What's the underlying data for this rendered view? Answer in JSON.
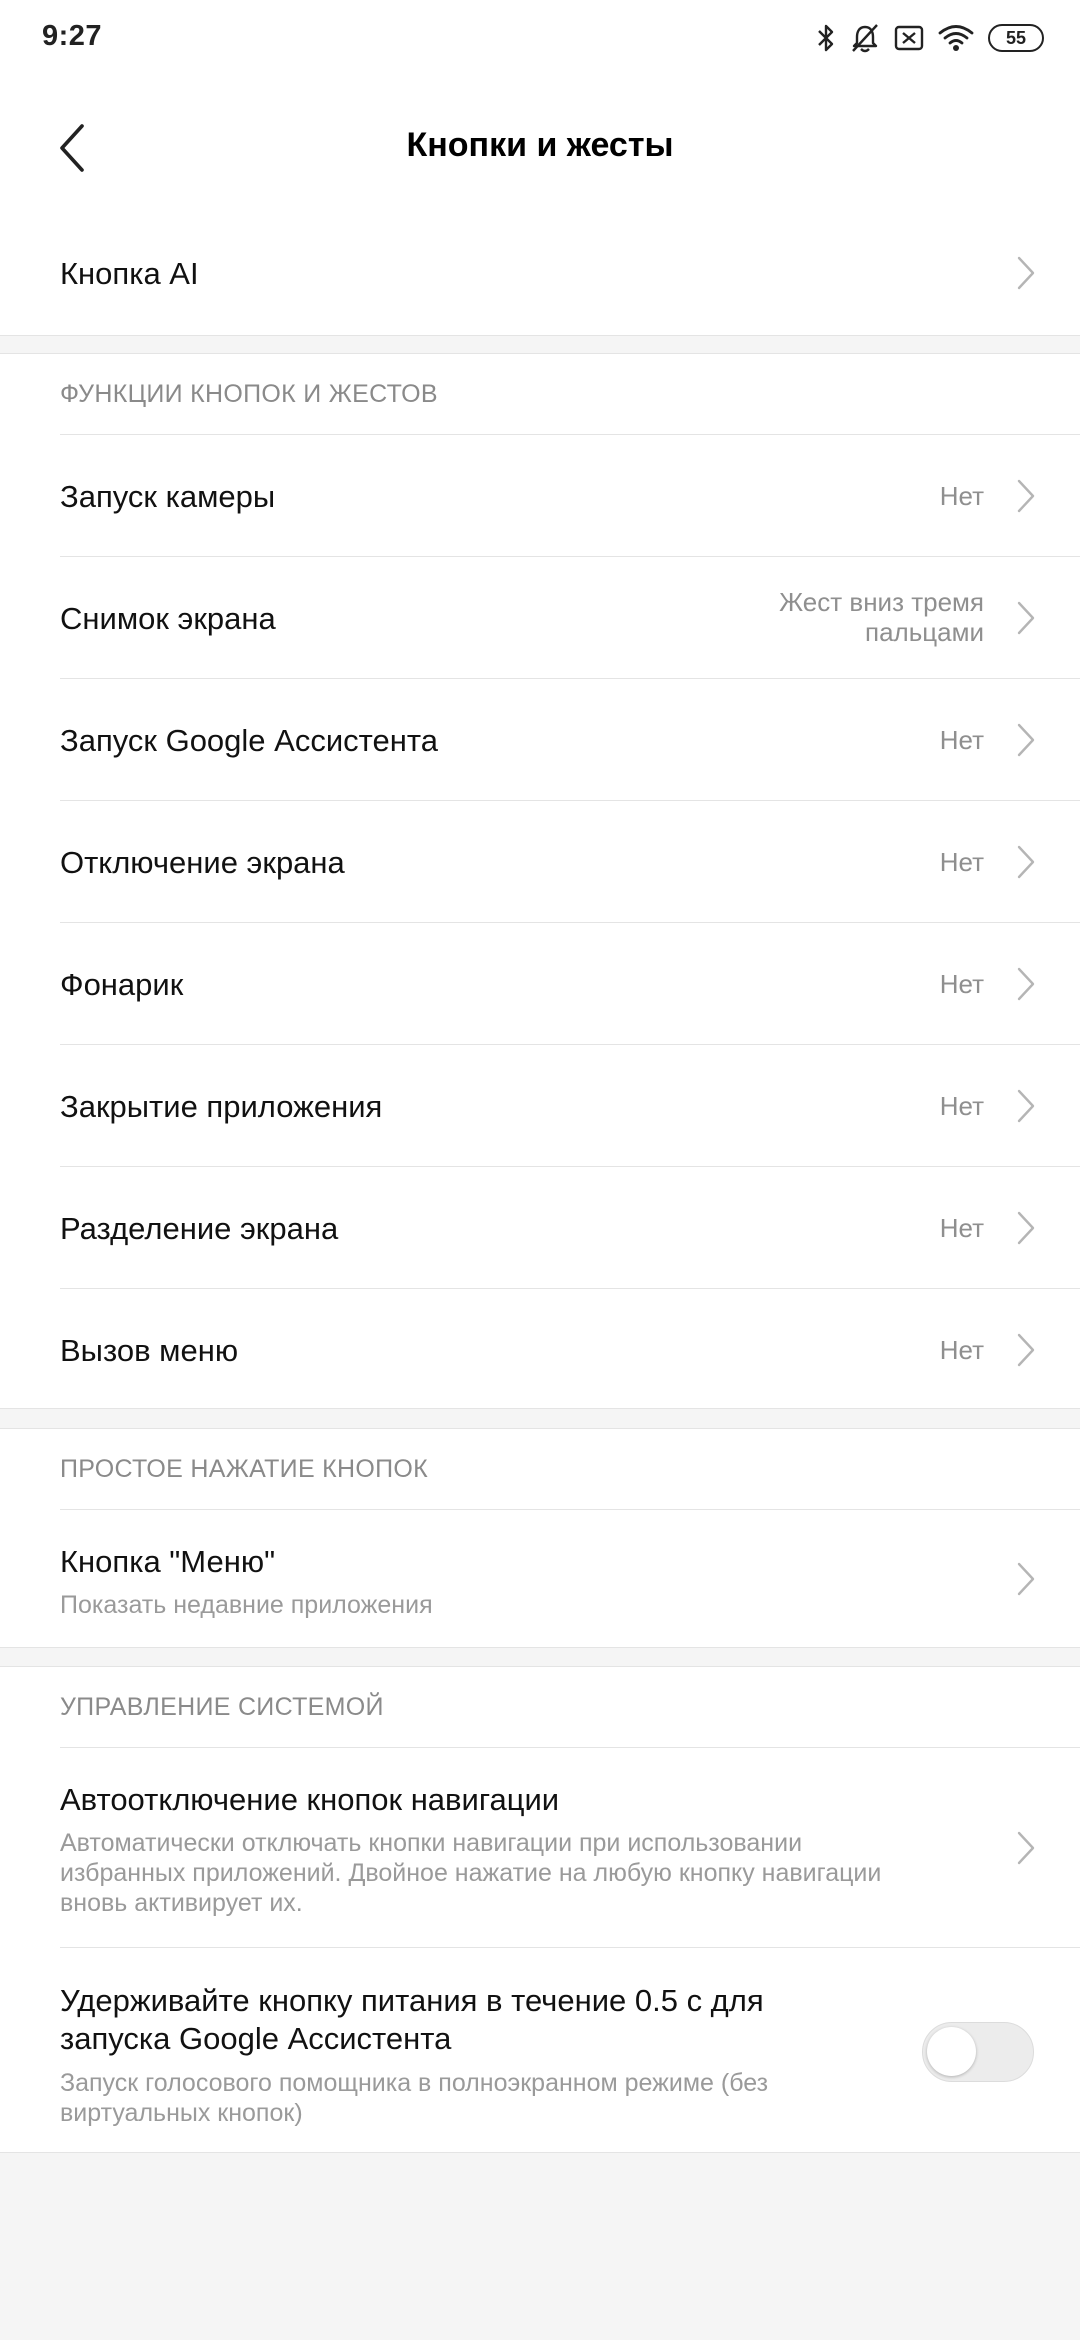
{
  "status_bar": {
    "time": "9:27",
    "battery": "55",
    "icons": [
      "bluetooth-icon",
      "alarm-off-icon",
      "sim-off-icon",
      "wifi-icon",
      "battery-icon"
    ]
  },
  "header": {
    "title": "Кнопки и жесты",
    "back_icon": "chevron-left-icon"
  },
  "ai_button": {
    "title": "Кнопка AI"
  },
  "gestures": {
    "header": "ФУНКЦИИ КНОПОК И ЖЕСТОВ",
    "items": [
      {
        "title": "Запуск камеры",
        "value": "Нет"
      },
      {
        "title": "Снимок экрана",
        "value_line1": "Жест вниз тремя",
        "value_line2": "пальцами"
      },
      {
        "title": "Запуск Google Ассистента",
        "value": "Нет"
      },
      {
        "title": "Отключение экрана",
        "value": "Нет"
      },
      {
        "title": "Фонарик",
        "value": "Нет"
      },
      {
        "title": "Закрытие приложения",
        "value": "Нет"
      },
      {
        "title": "Разделение экрана",
        "value": "Нет"
      },
      {
        "title": "Вызов меню",
        "value": "Нет"
      }
    ]
  },
  "simple_press": {
    "header": "ПРОСТОЕ НАЖАТИЕ КНОПОК",
    "items": [
      {
        "title": "Кнопка \"Меню\"",
        "subtitle": "Показать недавние приложения"
      }
    ]
  },
  "system_control": {
    "header": "УПРАВЛЕНИЕ СИСТЕМОЙ",
    "items": [
      {
        "title": "Автоотключение кнопок навигации",
        "subtitle_lines": [
          "Автоматически отключать кнопки навигации при использовании",
          "избранных приложений. Двойное нажатие на любую кнопку навигации",
          "вновь активирует их."
        ]
      },
      {
        "title_lines": [
          "Удерживайте кнопку питания в течение 0.5 с для",
          "запуска Google Ассистента"
        ],
        "subtitle_lines": [
          "Запуск голосового помощника в полноэкранном режиме (без",
          "виртуальных кнопок)"
        ],
        "toggle_on": false
      }
    ]
  }
}
